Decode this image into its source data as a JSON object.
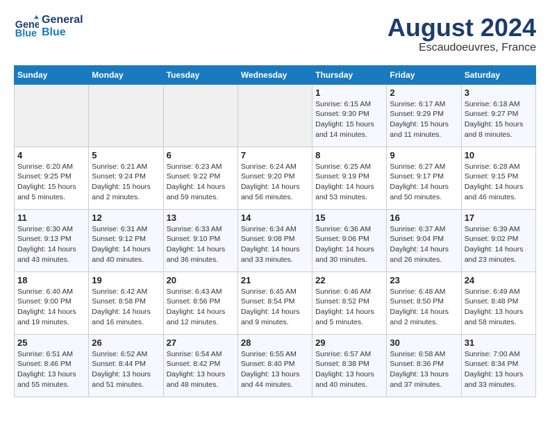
{
  "header": {
    "logo_line1": "General",
    "logo_line2": "Blue",
    "title": "August 2024",
    "subtitle": "Escaudoeuvres, France"
  },
  "days_of_week": [
    "Sunday",
    "Monday",
    "Tuesday",
    "Wednesday",
    "Thursday",
    "Friday",
    "Saturday"
  ],
  "weeks": [
    [
      {
        "day": "",
        "empty": true
      },
      {
        "day": "",
        "empty": true
      },
      {
        "day": "",
        "empty": true
      },
      {
        "day": "",
        "empty": true
      },
      {
        "day": "1",
        "sunrise": "Sunrise: 6:15 AM",
        "sunset": "Sunset: 9:30 PM",
        "daylight": "Daylight: 15 hours and 14 minutes."
      },
      {
        "day": "2",
        "sunrise": "Sunrise: 6:17 AM",
        "sunset": "Sunset: 9:29 PM",
        "daylight": "Daylight: 15 hours and 11 minutes."
      },
      {
        "day": "3",
        "sunrise": "Sunrise: 6:18 AM",
        "sunset": "Sunset: 9:27 PM",
        "daylight": "Daylight: 15 hours and 8 minutes."
      }
    ],
    [
      {
        "day": "4",
        "sunrise": "Sunrise: 6:20 AM",
        "sunset": "Sunset: 9:25 PM",
        "daylight": "Daylight: 15 hours and 5 minutes."
      },
      {
        "day": "5",
        "sunrise": "Sunrise: 6:21 AM",
        "sunset": "Sunset: 9:24 PM",
        "daylight": "Daylight: 15 hours and 2 minutes."
      },
      {
        "day": "6",
        "sunrise": "Sunrise: 6:23 AM",
        "sunset": "Sunset: 9:22 PM",
        "daylight": "Daylight: 14 hours and 59 minutes."
      },
      {
        "day": "7",
        "sunrise": "Sunrise: 6:24 AM",
        "sunset": "Sunset: 9:20 PM",
        "daylight": "Daylight: 14 hours and 56 minutes."
      },
      {
        "day": "8",
        "sunrise": "Sunrise: 6:25 AM",
        "sunset": "Sunset: 9:19 PM",
        "daylight": "Daylight: 14 hours and 53 minutes."
      },
      {
        "day": "9",
        "sunrise": "Sunrise: 6:27 AM",
        "sunset": "Sunset: 9:17 PM",
        "daylight": "Daylight: 14 hours and 50 minutes."
      },
      {
        "day": "10",
        "sunrise": "Sunrise: 6:28 AM",
        "sunset": "Sunset: 9:15 PM",
        "daylight": "Daylight: 14 hours and 46 minutes."
      }
    ],
    [
      {
        "day": "11",
        "sunrise": "Sunrise: 6:30 AM",
        "sunset": "Sunset: 9:13 PM",
        "daylight": "Daylight: 14 hours and 43 minutes."
      },
      {
        "day": "12",
        "sunrise": "Sunrise: 6:31 AM",
        "sunset": "Sunset: 9:12 PM",
        "daylight": "Daylight: 14 hours and 40 minutes."
      },
      {
        "day": "13",
        "sunrise": "Sunrise: 6:33 AM",
        "sunset": "Sunset: 9:10 PM",
        "daylight": "Daylight: 14 hours and 36 minutes."
      },
      {
        "day": "14",
        "sunrise": "Sunrise: 6:34 AM",
        "sunset": "Sunset: 9:08 PM",
        "daylight": "Daylight: 14 hours and 33 minutes."
      },
      {
        "day": "15",
        "sunrise": "Sunrise: 6:36 AM",
        "sunset": "Sunset: 9:06 PM",
        "daylight": "Daylight: 14 hours and 30 minutes."
      },
      {
        "day": "16",
        "sunrise": "Sunrise: 6:37 AM",
        "sunset": "Sunset: 9:04 PM",
        "daylight": "Daylight: 14 hours and 26 minutes."
      },
      {
        "day": "17",
        "sunrise": "Sunrise: 6:39 AM",
        "sunset": "Sunset: 9:02 PM",
        "daylight": "Daylight: 14 hours and 23 minutes."
      }
    ],
    [
      {
        "day": "18",
        "sunrise": "Sunrise: 6:40 AM",
        "sunset": "Sunset: 9:00 PM",
        "daylight": "Daylight: 14 hours and 19 minutes."
      },
      {
        "day": "19",
        "sunrise": "Sunrise: 6:42 AM",
        "sunset": "Sunset: 8:58 PM",
        "daylight": "Daylight: 14 hours and 16 minutes."
      },
      {
        "day": "20",
        "sunrise": "Sunrise: 6:43 AM",
        "sunset": "Sunset: 8:56 PM",
        "daylight": "Daylight: 14 hours and 12 minutes."
      },
      {
        "day": "21",
        "sunrise": "Sunrise: 6:45 AM",
        "sunset": "Sunset: 8:54 PM",
        "daylight": "Daylight: 14 hours and 9 minutes."
      },
      {
        "day": "22",
        "sunrise": "Sunrise: 6:46 AM",
        "sunset": "Sunset: 8:52 PM",
        "daylight": "Daylight: 14 hours and 5 minutes."
      },
      {
        "day": "23",
        "sunrise": "Sunrise: 6:48 AM",
        "sunset": "Sunset: 8:50 PM",
        "daylight": "Daylight: 14 hours and 2 minutes."
      },
      {
        "day": "24",
        "sunrise": "Sunrise: 6:49 AM",
        "sunset": "Sunset: 8:48 PM",
        "daylight": "Daylight: 13 hours and 58 minutes."
      }
    ],
    [
      {
        "day": "25",
        "sunrise": "Sunrise: 6:51 AM",
        "sunset": "Sunset: 8:46 PM",
        "daylight": "Daylight: 13 hours and 55 minutes."
      },
      {
        "day": "26",
        "sunrise": "Sunrise: 6:52 AM",
        "sunset": "Sunset: 8:44 PM",
        "daylight": "Daylight: 13 hours and 51 minutes."
      },
      {
        "day": "27",
        "sunrise": "Sunrise: 6:54 AM",
        "sunset": "Sunset: 8:42 PM",
        "daylight": "Daylight: 13 hours and 48 minutes."
      },
      {
        "day": "28",
        "sunrise": "Sunrise: 6:55 AM",
        "sunset": "Sunset: 8:40 PM",
        "daylight": "Daylight: 13 hours and 44 minutes."
      },
      {
        "day": "29",
        "sunrise": "Sunrise: 6:57 AM",
        "sunset": "Sunset: 8:38 PM",
        "daylight": "Daylight: 13 hours and 40 minutes."
      },
      {
        "day": "30",
        "sunrise": "Sunrise: 6:58 AM",
        "sunset": "Sunset: 8:36 PM",
        "daylight": "Daylight: 13 hours and 37 minutes."
      },
      {
        "day": "31",
        "sunrise": "Sunrise: 7:00 AM",
        "sunset": "Sunset: 8:34 PM",
        "daylight": "Daylight: 13 hours and 33 minutes."
      }
    ]
  ]
}
